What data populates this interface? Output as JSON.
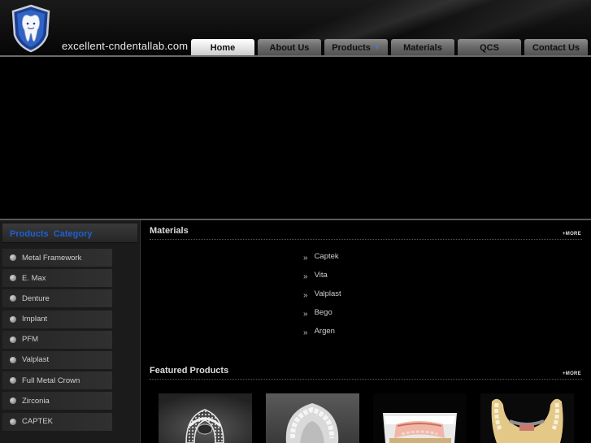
{
  "header": {
    "site_name": "excellent-cndentallab.com",
    "logo_icon": "tooth-shield-logo"
  },
  "nav": {
    "items": [
      {
        "label": "Home",
        "active": true
      },
      {
        "label": "About Us"
      },
      {
        "label": "Products",
        "dropdown_icon": "caret-down-icon"
      },
      {
        "label": "Materials"
      },
      {
        "label": "QCS"
      },
      {
        "label": "Contact Us"
      }
    ]
  },
  "sidebar": {
    "title": "Products  Category",
    "items": [
      "Metal Framework",
      "E. Max",
      "Denture",
      "Implant",
      "PFM",
      "Valplast",
      "Full Metal Crown",
      "Zirconia",
      "CAPTEK"
    ]
  },
  "materials": {
    "title": "Materials",
    "more_label": "+MORE",
    "items": [
      "Captek",
      "Vita",
      "Valplast",
      "Bego",
      "Argen"
    ]
  },
  "featured": {
    "title": "Featured Products",
    "more_label": "+MORE",
    "products": [
      "metal-framework-photo",
      "dental-model-photo",
      "denture-photo",
      "implant-bar-photo"
    ]
  },
  "colors": {
    "accent_blue": "#1f5fd0",
    "background": "#000000"
  }
}
